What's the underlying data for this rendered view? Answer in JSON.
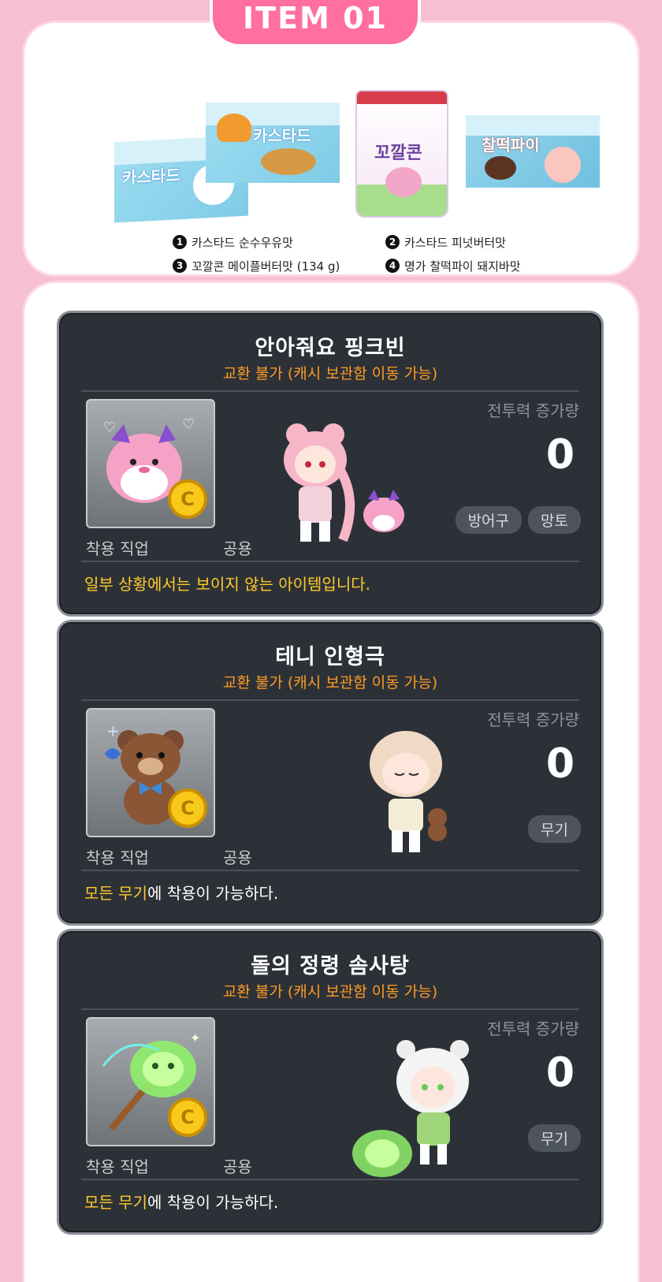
{
  "header": {
    "tag": "ITEM 01"
  },
  "products": {
    "box1": "카스타드",
    "box2": "카스타드",
    "bag": "꼬깔콘",
    "box4": "찰떡파이",
    "legend": [
      {
        "num": "1",
        "label": "카스타드 순수우유맛"
      },
      {
        "num": "2",
        "label": "카스타드 피넛버터맛"
      },
      {
        "num": "3",
        "label": "꼬깔콘 메이플버터맛 (134 g)"
      },
      {
        "num": "4",
        "label": "명가 찰떡파이 돼지바맛"
      }
    ]
  },
  "items": [
    {
      "title": "안아줘요 핑크빈",
      "trade": "교환 불가 (캐시 보관함 이동 가능)",
      "power_label": "전투력 증가량",
      "power_value": "0",
      "tags": [
        "방어구",
        "망토"
      ],
      "jobs_label": "착용 직업",
      "jobs_value": "공용",
      "desc_hl": "일부 상황에서는 보이지 않는 아이템입니다.",
      "desc_rest": "",
      "coin": "C",
      "icon": "pink-bean-icon"
    },
    {
      "title": "테니 인형극",
      "trade": "교환 불가 (캐시 보관함 이동 가능)",
      "power_label": "전투력 증가량",
      "power_value": "0",
      "tags": [
        "무기"
      ],
      "jobs_label": "착용 직업",
      "jobs_value": "공용",
      "desc_hl1": "모든",
      "desc_hl2": "무기",
      "desc_rest": "에 착용이 가능하다.",
      "coin": "C",
      "icon": "teddy-bear-icon"
    },
    {
      "title": "돌의 정령 솜사탕",
      "trade": "교환 불가 (캐시 보관함 이동 가능)",
      "power_label": "전투력 증가량",
      "power_value": "0",
      "tags": [
        "무기"
      ],
      "jobs_label": "착용 직업",
      "jobs_value": "공용",
      "desc_hl1": "모든",
      "desc_hl2": "무기",
      "desc_rest": "에 착용이 가능하다.",
      "coin": "C",
      "icon": "cotton-candy-icon"
    }
  ],
  "colors": {
    "background": "#f7bfd2",
    "accent": "#ff6fa0",
    "tooltip_bg": "#2c3138",
    "trade_text": "#ff9b23",
    "highlight_text": "#ffca28"
  }
}
